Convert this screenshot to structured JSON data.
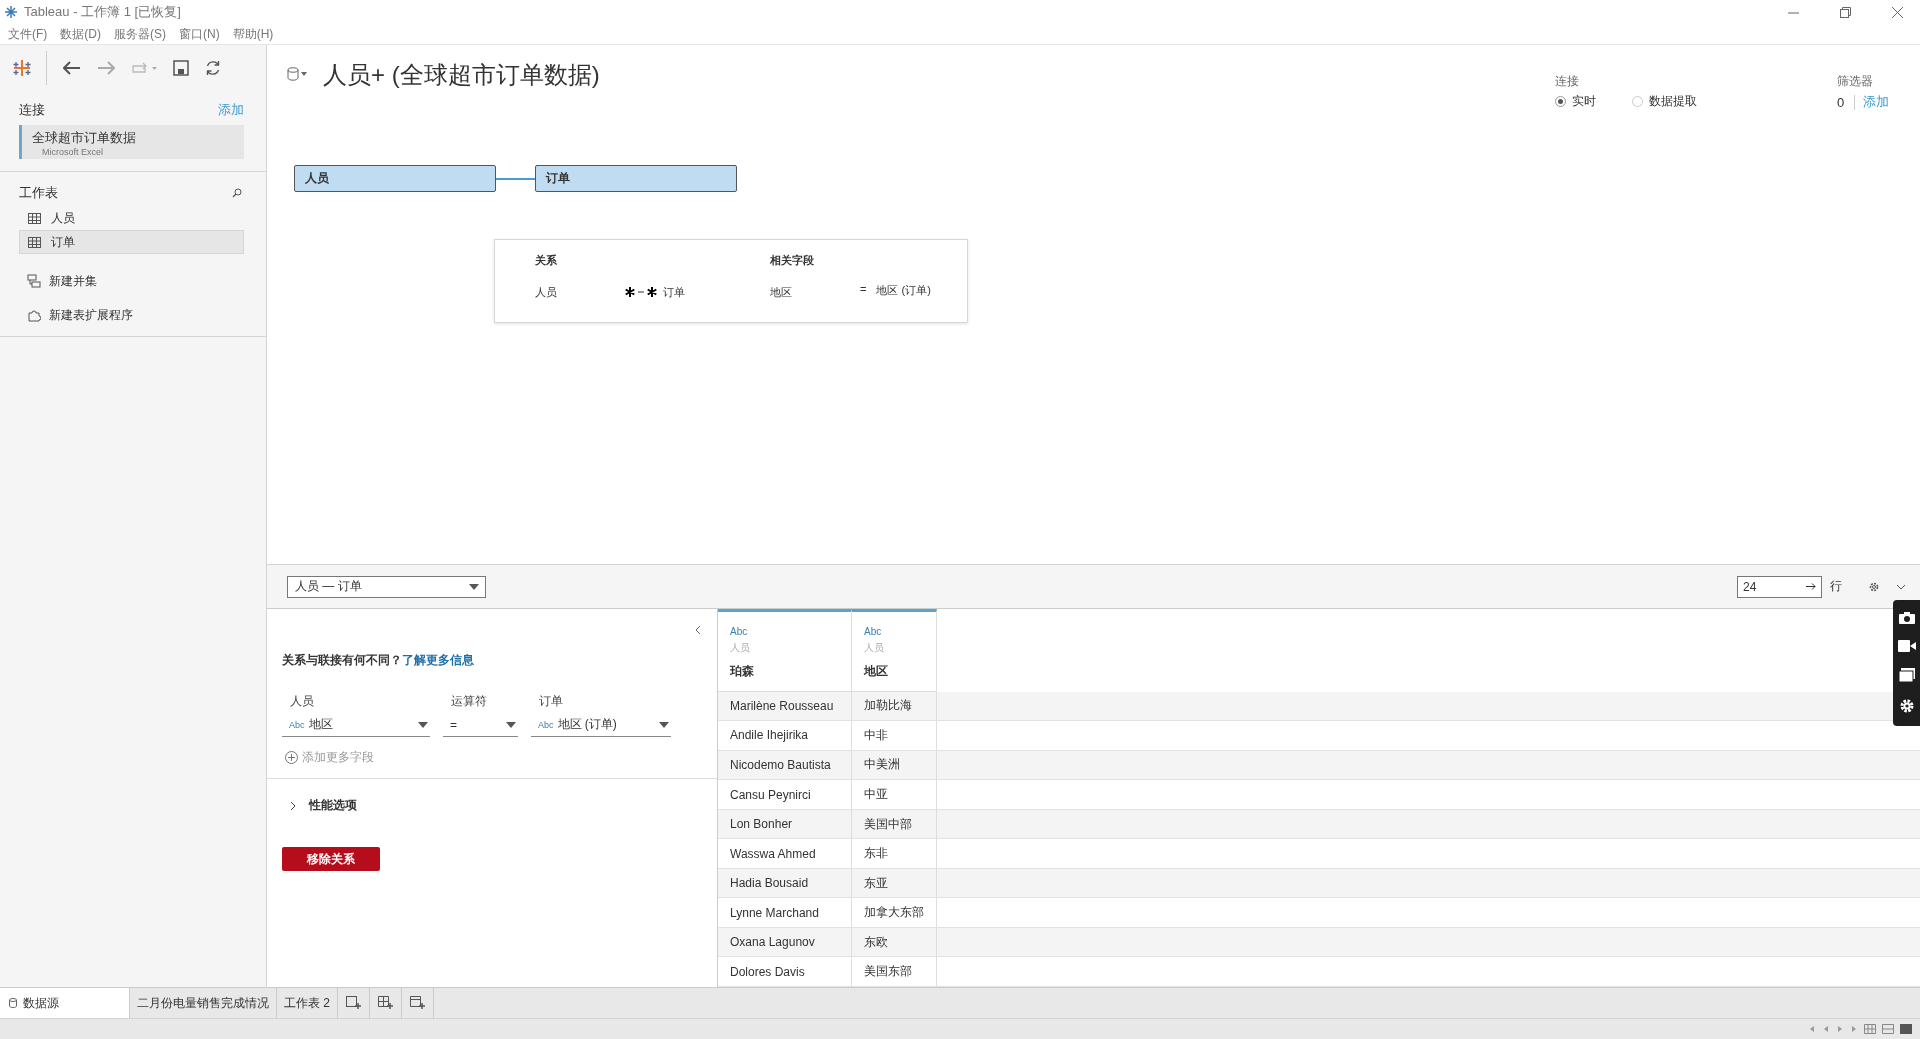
{
  "window": {
    "title": "Tableau - 工作簿 1 [已恢复]"
  },
  "menu": [
    "文件(F)",
    "数据(D)",
    "服务器(S)",
    "窗口(N)",
    "帮助(H)"
  ],
  "sidebar": {
    "connections_label": "连接",
    "add_link": "添加",
    "connections": [
      {
        "name": "全球超市订单数据",
        "type": "Microsoft Excel",
        "selected": true
      }
    ],
    "sheets_label": "工作表",
    "sheets": [
      {
        "name": "人员",
        "selected": false
      },
      {
        "name": "订单",
        "selected": true
      }
    ],
    "actions": [
      {
        "kind": "union",
        "label": "新建并集"
      },
      {
        "kind": "extension",
        "label": "新建表扩展程序"
      }
    ]
  },
  "header": {
    "title": "人员+ (全球超市订单数据)",
    "connection_label": "连接",
    "connection_options": [
      {
        "label": "实时",
        "selected": true
      },
      {
        "label": "数据提取",
        "selected": false
      }
    ],
    "filters_label": "筛选器",
    "filters_count": "0",
    "filters_add": "添加"
  },
  "canvas": {
    "tables": [
      "人员",
      "订单"
    ],
    "popup": {
      "relation_heading": "关系",
      "fields_heading": "相关字段",
      "left_table": "人员",
      "right_table": "订单",
      "left_field": "地区",
      "operator": "=",
      "right_field": "地区 (订单)"
    }
  },
  "preview_bar": {
    "relationship": "人员 — 订单",
    "rows_value": "24",
    "rows_label": "行"
  },
  "editor": {
    "question": "关系与联接有何不同？",
    "link": "了解更多信息",
    "columns": [
      "人员",
      "运算符",
      "订单"
    ],
    "fields": [
      {
        "type": "Abc",
        "value": "地区"
      },
      {
        "value": "="
      },
      {
        "type": "Abc",
        "value": "地区 (订单)"
      }
    ],
    "add_field": "添加更多字段",
    "performance": "性能选项",
    "expanded": false,
    "remove": "移除关系"
  },
  "grid": {
    "columns": [
      {
        "type": "Abc",
        "table": "人员",
        "name": "珀森"
      },
      {
        "type": "Abc",
        "table": "人员",
        "name": "地区"
      }
    ],
    "rows": [
      [
        "Marilène Rousseau",
        "加勒比海"
      ],
      [
        "Andile Ihejirika",
        "中非"
      ],
      [
        "Nicodemo Bautista",
        "中美洲"
      ],
      [
        "Cansu Peynirci",
        "中亚"
      ],
      [
        "Lon Bonher",
        "美国中部"
      ],
      [
        "Wasswa Ahmed",
        "东非"
      ],
      [
        "Hadia Bousaid",
        "东亚"
      ],
      [
        "Lynne Marchand",
        "加拿大东部"
      ],
      [
        "Oxana Lagunov",
        "东欧"
      ],
      [
        "Dolores Davis",
        "美国东部"
      ]
    ]
  },
  "tabs": [
    {
      "kind": "datasource",
      "label": "数据源",
      "selected": true
    },
    {
      "kind": "sheet",
      "label": "二月份电量销售完成情况",
      "selected": false
    },
    {
      "kind": "sheet",
      "label": "工作表 2",
      "selected": false
    }
  ]
}
